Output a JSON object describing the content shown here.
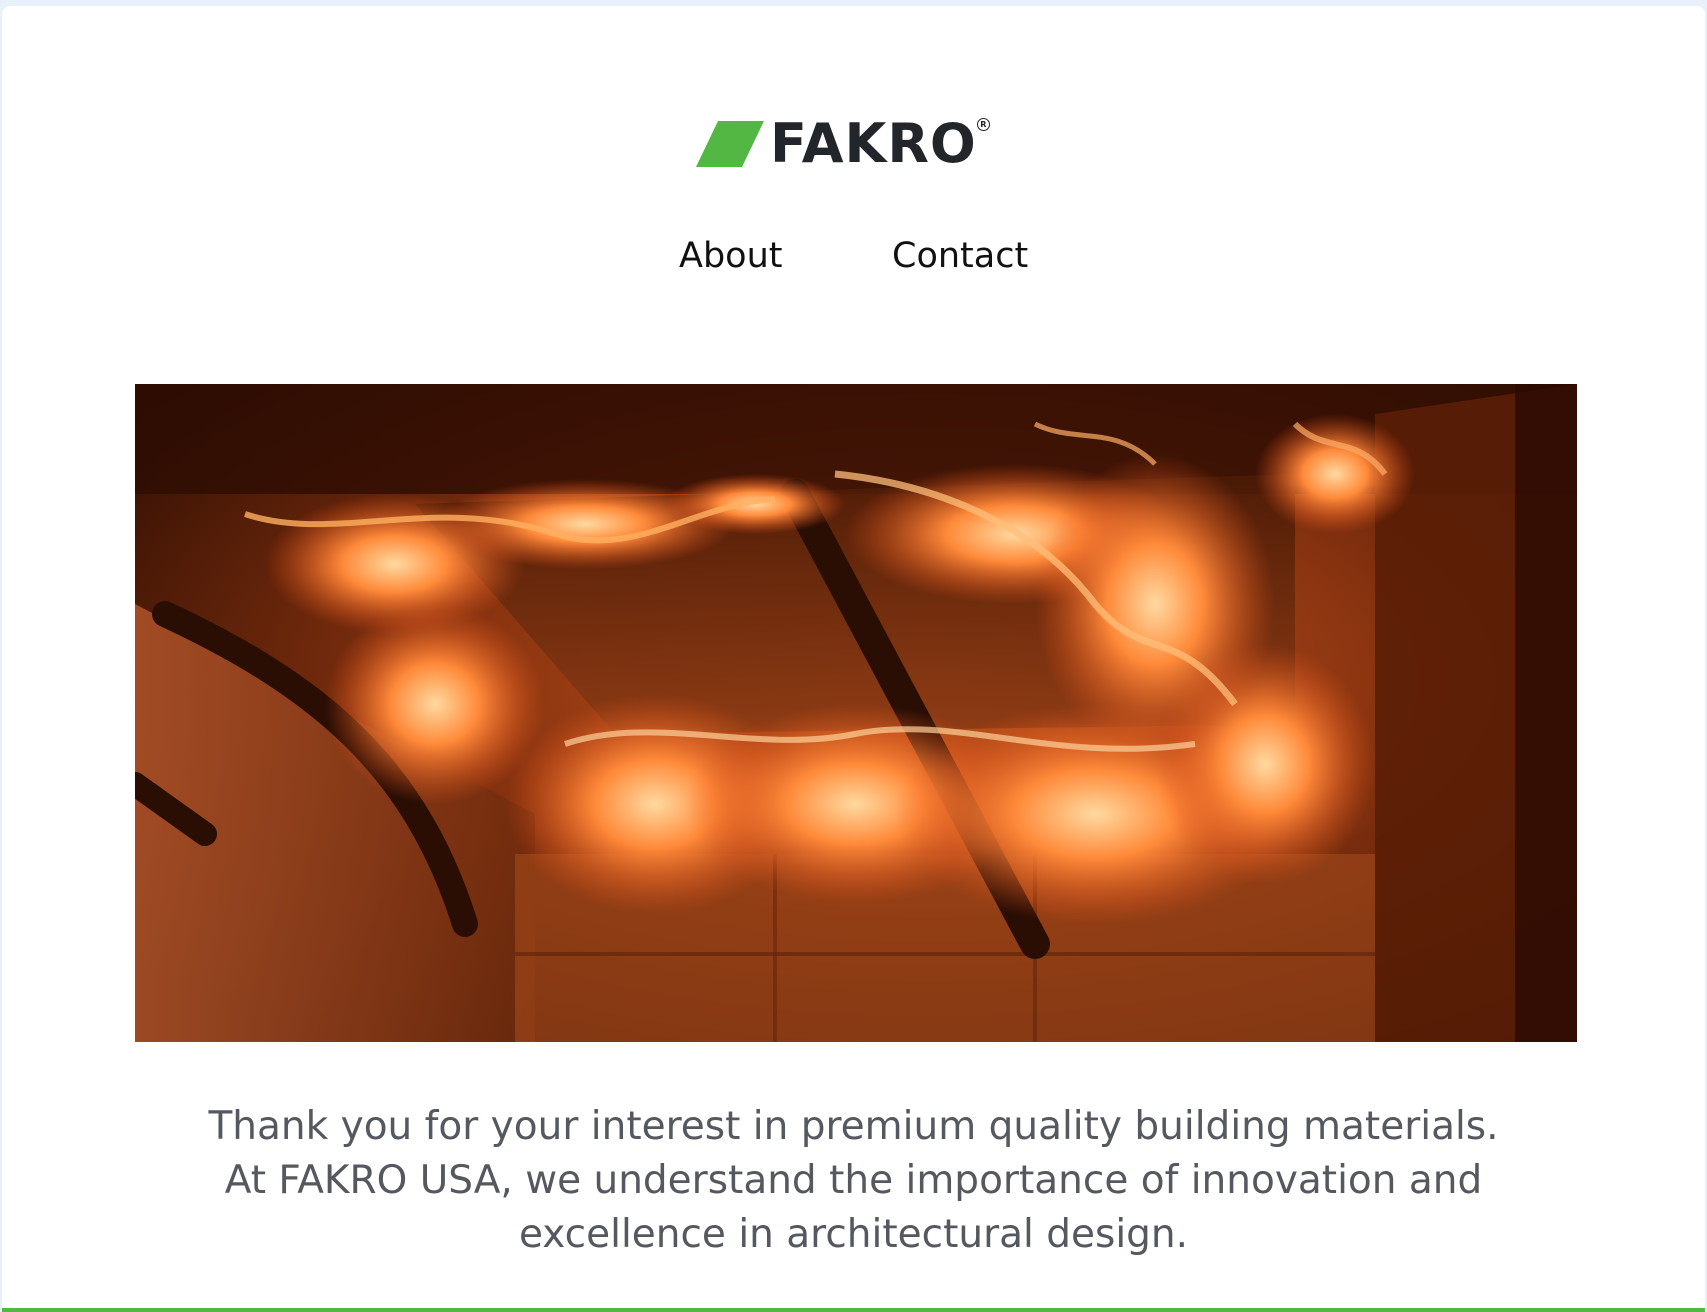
{
  "brand": {
    "name": "FAKRO",
    "registered_mark": "R",
    "accent_color": "#52b843",
    "text_color": "#22252a"
  },
  "nav": {
    "items": [
      {
        "label": "About"
      },
      {
        "label": "Contact"
      }
    ]
  },
  "hero": {
    "icon": "fire-test-photo"
  },
  "intro": {
    "lines": [
      "Thank you for your interest in premium quality building materials.",
      "At FAKRO USA, we understand the importance of innovation and",
      "excellence in architectural design."
    ]
  }
}
